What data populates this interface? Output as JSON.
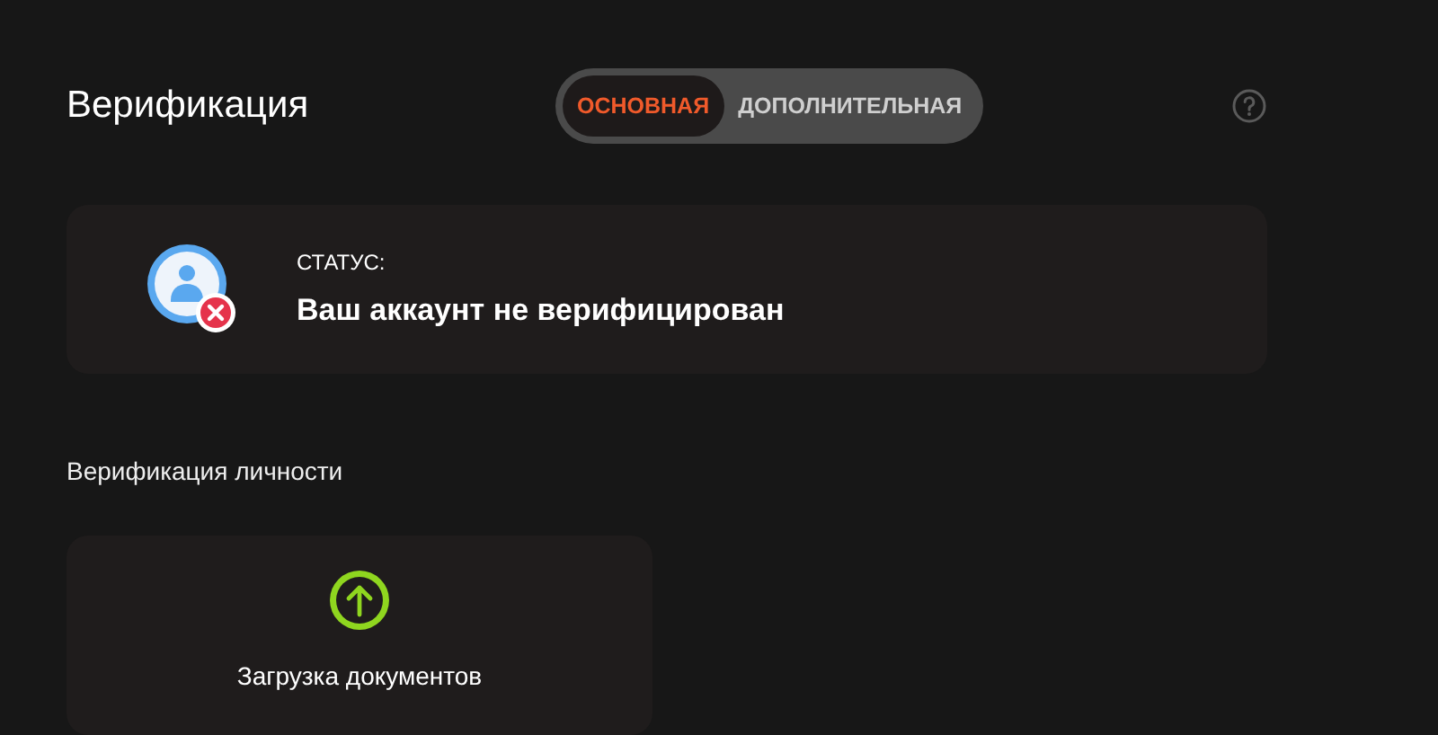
{
  "header": {
    "title": "Верификация",
    "tabs": [
      {
        "label": "ОСНОВНАЯ",
        "selected": true
      },
      {
        "label": "ДОПОЛНИТЕЛЬНАЯ",
        "selected": false
      }
    ]
  },
  "status": {
    "label": "СТАТУС:",
    "text": "Ваш аккаунт не верифицирован",
    "verified": false
  },
  "section": {
    "title": "Верификация личности",
    "upload": {
      "label": "Загрузка документов"
    }
  }
}
